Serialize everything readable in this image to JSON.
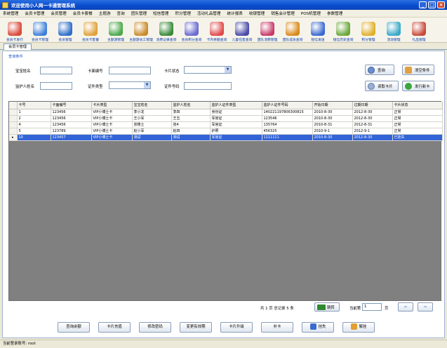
{
  "window": {
    "title": "欢迎使用小人网一卡通管理系统"
  },
  "menu": [
    "系统管理",
    "会员卡管理",
    "会员管理",
    "会员卡套餐",
    "主题游",
    "查询",
    "团队管理",
    "短信管理",
    "积分管理",
    "活动礼品管理",
    "统计报表",
    "收银管理",
    "销售会计管理",
    "POS机管理",
    "参数管理"
  ],
  "toolbar": [
    {
      "label": "会员卡发行",
      "icon": "card-stack-icon",
      "color": "#d94a3a"
    },
    {
      "label": "会员卡管理",
      "icon": "card-icon",
      "color": "#3f7fd8"
    },
    {
      "label": "会员管理",
      "icon": "user-icon",
      "color": "#2f6fc9"
    },
    {
      "label": "会员卡套餐",
      "icon": "chart-icon",
      "color": "#e0a13a"
    },
    {
      "label": "主题游管理",
      "icon": "tree-icon",
      "color": "#4ca84a"
    },
    {
      "label": "主题游员工管理",
      "icon": "pencil-icon",
      "color": "#c98a2a"
    },
    {
      "label": "消费记录查询",
      "icon": "book-icon",
      "color": "#3a8a3a"
    },
    {
      "label": "会员积分查询",
      "icon": "tools-icon",
      "color": "#6a6ad0"
    },
    {
      "label": "卡内余额查询",
      "icon": "gift-icon",
      "color": "#e04a4a"
    },
    {
      "label": "儿童在套查询",
      "icon": "magnifier-icon",
      "color": "#4a4aa8"
    },
    {
      "label": "团队消费管理",
      "icon": "scissors-icon",
      "color": "#c83a6a"
    },
    {
      "label": "团队成员查询",
      "icon": "people-icon",
      "color": "#d98a1a"
    },
    {
      "label": "短信发送",
      "icon": "messages-icon",
      "color": "#3a6ad0"
    },
    {
      "label": "短信历史查询",
      "icon": "note-icon",
      "color": "#6aa83a"
    },
    {
      "label": "积分管理",
      "icon": "coins-icon",
      "color": "#e0b02a"
    },
    {
      "label": "活动管理",
      "icon": "balloon-icon",
      "color": "#3aa8c8"
    },
    {
      "label": "礼品管理",
      "icon": "box-icon",
      "color": "#c84a3a"
    }
  ],
  "tab": {
    "label": "会员卡管理"
  },
  "query": {
    "group_title": "查询条件",
    "member_name_label": "宝宝姓名",
    "card_no_label": "卡面编号",
    "card_status_label": "卡片状态",
    "guardian_name_label": "监护人姓名",
    "id_type_label": "证件类型",
    "id_no_label": "证件号码",
    "search_label": "查询",
    "clear_label": "清空条件",
    "read_card_label": "读取卡片",
    "issue_card_label": "发行新卡"
  },
  "table": {
    "headers": [
      "卡号",
      "卡面编号",
      "卡片类型",
      "宝宝姓名",
      "监护人姓名",
      "监护人证件类型",
      "监护人证件号码",
      "开始日期",
      "过期日期",
      "卡片状态"
    ],
    "rows": [
      [
        "1",
        "123456",
        "VIP小博士卡",
        "李小龙",
        "李四",
        "身份证",
        "140221197806300815",
        "2010-8-30",
        "2012-8-30",
        "正常"
      ],
      [
        "2",
        "123456",
        "VIP小博士卡",
        "王小军",
        "王五",
        "军官证",
        "123546",
        "2010-8-30",
        "2012-8-30",
        "正常"
      ],
      [
        "4",
        "123456",
        "VIP小博士卡",
        "张楼士",
        "张4",
        "军官证",
        "135764",
        "2010-8-31",
        "2012-8-31",
        "正常"
      ],
      [
        "5",
        "123789",
        "VIP小博士卡",
        "赵小军",
        "赵四",
        "护照",
        "456325",
        "2010-9-1",
        "2012-9-1",
        "正常"
      ],
      [
        "10",
        "123457",
        "VIP小博士卡",
        "测试",
        "测试",
        "军官证",
        "1111111",
        "2010-8-30",
        "2012-8-30",
        "已挂失"
      ]
    ],
    "selected_row": 4
  },
  "pager": {
    "summary": "共 1 页 总记录 5 条",
    "jump_label": "跳转",
    "page_prefix": "当前第",
    "page_value": "1",
    "page_suffix": "页"
  },
  "actions": [
    "查询余额",
    "卡片充值",
    "修改密码",
    "变更有效期",
    "卡片升级",
    "补卡",
    "挂失",
    "解挂"
  ],
  "status": {
    "text": "当前登录账号: root"
  }
}
